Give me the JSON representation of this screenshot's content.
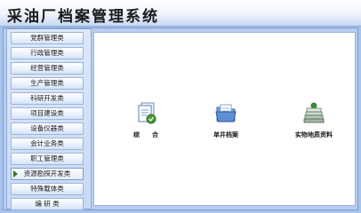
{
  "app": {
    "title": "采油厂档案管理系统"
  },
  "sidebar": {
    "items": [
      {
        "label": "党群管理类"
      },
      {
        "label": "行政管理类"
      },
      {
        "label": "经营管理类"
      },
      {
        "label": "生产管理类"
      },
      {
        "label": "科研开发类"
      },
      {
        "label": "项目建设类"
      },
      {
        "label": "设备仪器类"
      },
      {
        "label": "会计业务类"
      },
      {
        "label": "职工管理类"
      },
      {
        "label": "资源勘探开发类",
        "active": true
      },
      {
        "label": "特殊载体类"
      },
      {
        "label": "编 研 类"
      }
    ]
  },
  "modules": [
    {
      "label": "综　　合",
      "icon": "document-stack-icon"
    },
    {
      "label": "单井档案",
      "icon": "folder-icon"
    },
    {
      "label": "实物地质资料",
      "icon": "book-stack-icon"
    }
  ],
  "colors": {
    "background": "#a9c4ea",
    "active_arrow": "#2d7a1f"
  }
}
